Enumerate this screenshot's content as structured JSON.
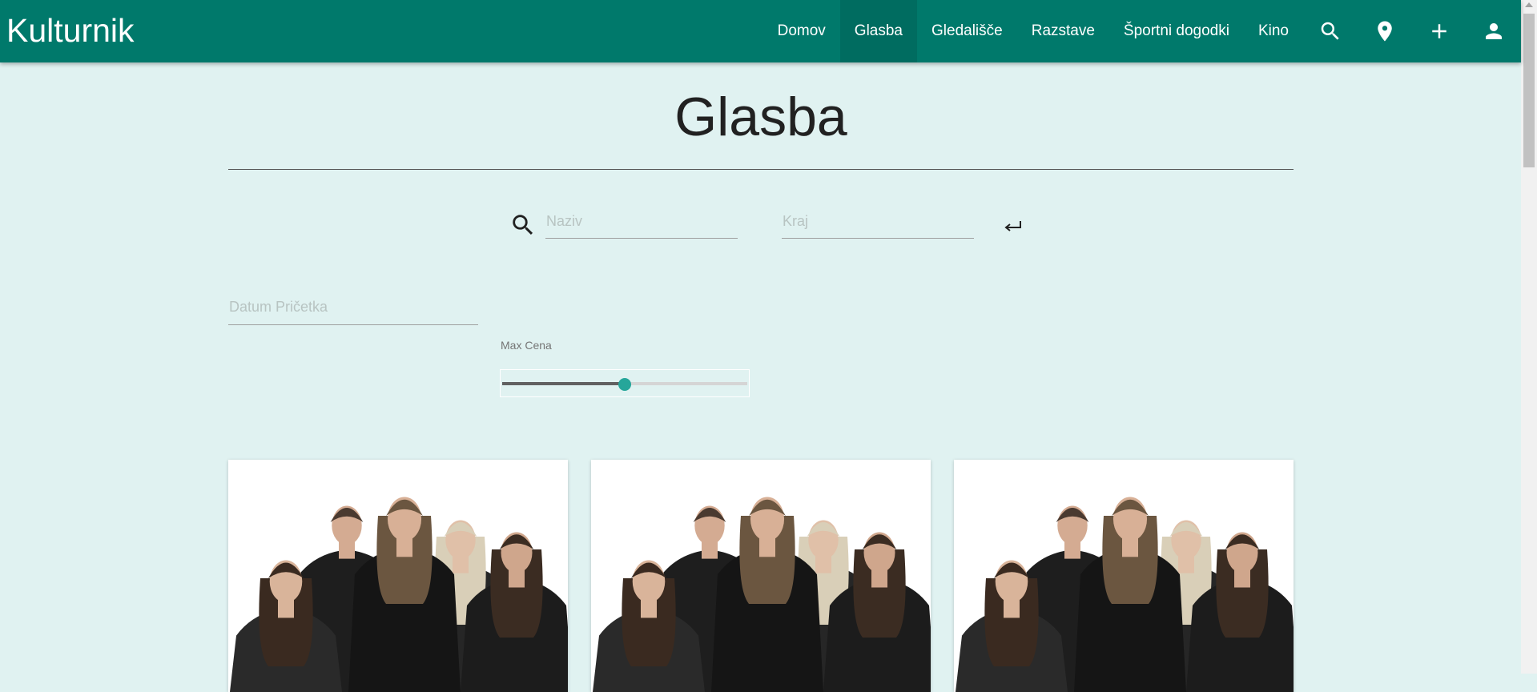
{
  "navbar": {
    "brand": "Kulturnik",
    "links": [
      {
        "label": "Domov"
      },
      {
        "label": "Glasba"
      },
      {
        "label": "Gledališče"
      },
      {
        "label": "Razstave"
      },
      {
        "label": "Športni dogodki"
      },
      {
        "label": "Kino"
      }
    ],
    "active_link": "Glasba",
    "icons": [
      "search-icon",
      "location-pin-icon",
      "plus-icon",
      "account-icon"
    ],
    "color": "#00796b"
  },
  "page": {
    "title": "Glasba",
    "background": "#e0f2f1"
  },
  "filters": {
    "naziv": {
      "placeholder": "Naziv",
      "value": ""
    },
    "kraj": {
      "placeholder": "Kraj",
      "value": ""
    },
    "datum": {
      "placeholder": "Datum Pričetka",
      "value": ""
    },
    "max_cena": {
      "label": "Max Cena",
      "fraction": 0.5,
      "accent": "#26a69a"
    }
  },
  "cards": [
    {
      "image": "band-photo"
    },
    {
      "image": "band-photo"
    },
    {
      "image": "band-photo"
    }
  ]
}
